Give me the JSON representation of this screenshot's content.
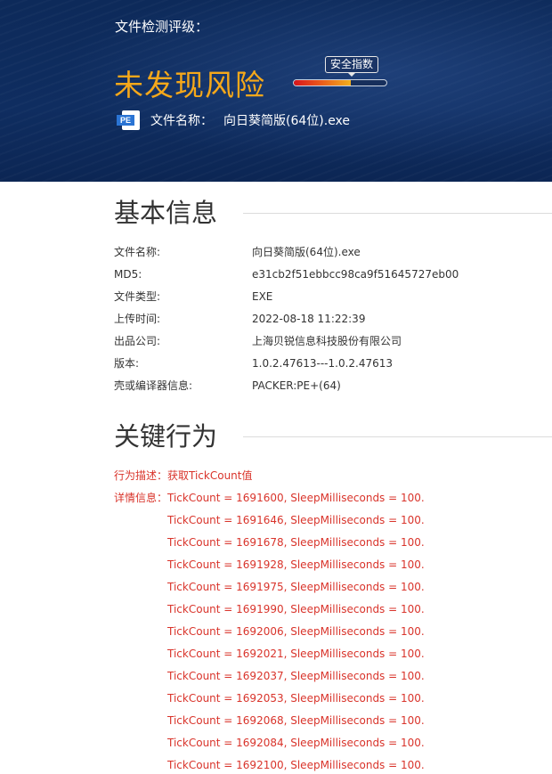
{
  "hero": {
    "label": "文件检测评级：",
    "risk_result": "未发现风险",
    "meter": {
      "badge": "安全指数",
      "level_percent": 62
    },
    "file_label": "文件名称：",
    "file_name": "向日葵简版(64位).exe",
    "file_icon": {
      "name": "pe-file-icon",
      "text": "PE"
    },
    "colors": {
      "background": "#0e2b5c",
      "risk_text": "#f6a81a"
    }
  },
  "basic_info": {
    "title": "基本信息",
    "rows": [
      {
        "label": "文件名称:",
        "value": "向日葵简版(64位).exe"
      },
      {
        "label": "MD5:",
        "value": "e31cb2f51ebbcc98ca9f51645727eb00"
      },
      {
        "label": "文件类型:",
        "value": "EXE"
      },
      {
        "label": "上传时间:",
        "value": "2022-08-18 11:22:39"
      },
      {
        "label": "出品公司:",
        "value": "上海贝锐信息科技股份有限公司"
      },
      {
        "label": "版本:",
        "value": "1.0.2.47613---1.0.2.47613"
      },
      {
        "label": "壳或编译器信息:",
        "value": "PACKER:PE+(64)"
      }
    ]
  },
  "key_behavior": {
    "title": "关键行为",
    "desc_label": "行为描述：",
    "desc_value": "获取TickCount值",
    "detail_label": "详情信息：",
    "details": [
      "TickCount = 1691600, SleepMilliseconds = 100.",
      "TickCount = 1691646, SleepMilliseconds = 100.",
      "TickCount = 1691678, SleepMilliseconds = 100.",
      "TickCount = 1691928, SleepMilliseconds = 100.",
      "TickCount = 1691975, SleepMilliseconds = 100.",
      "TickCount = 1691990, SleepMilliseconds = 100.",
      "TickCount = 1692006, SleepMilliseconds = 100.",
      "TickCount = 1692021, SleepMilliseconds = 100.",
      "TickCount = 1692037, SleepMilliseconds = 100.",
      "TickCount = 1692053, SleepMilliseconds = 100.",
      "TickCount = 1692068, SleepMilliseconds = 100.",
      "TickCount = 1692084, SleepMilliseconds = 100.",
      "TickCount = 1692100, SleepMilliseconds = 100."
    ],
    "colors": {
      "text": "#d9342b"
    }
  }
}
